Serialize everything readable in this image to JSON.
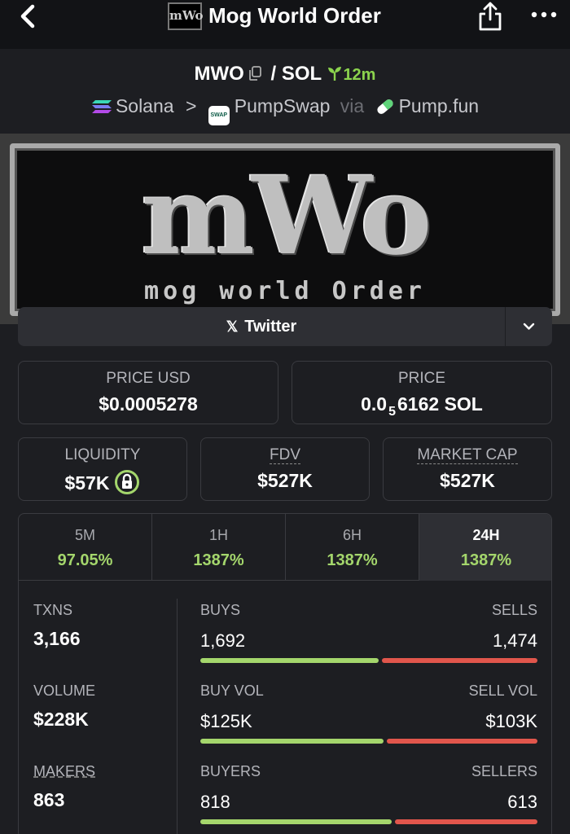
{
  "header": {
    "title": "Mog World Order",
    "logo_text": "mWo"
  },
  "pair": {
    "base": "MWO",
    "separator": "/",
    "quote": "SOL",
    "age": "12m"
  },
  "chain": {
    "network": "Solana",
    "arrow": ">",
    "dex": "PumpSwap",
    "dex_badge": "SWAP",
    "via": "via",
    "launchpad": "Pump.fun"
  },
  "banner": {
    "logo": "mWo",
    "subtitle": "mog world Order"
  },
  "social": {
    "twitter_label": "Twitter",
    "x_glyph": "𝕏"
  },
  "prices": {
    "price_usd_label": "PRICE USD",
    "price_usd": "$0.0005278",
    "price_label": "PRICE",
    "price_main": "0.0",
    "price_zeros": "5",
    "price_rest": "6162 SOL"
  },
  "metrics": {
    "liquidity_label": "LIQUIDITY",
    "liquidity": "$57K",
    "fdv_label": "FDV",
    "fdv": "$527K",
    "mcap_label": "MARKET CAP",
    "mcap": "$527K"
  },
  "tabs": [
    {
      "label": "5M",
      "pct": "97.05%"
    },
    {
      "label": "1H",
      "pct": "1387%"
    },
    {
      "label": "6H",
      "pct": "1387%"
    },
    {
      "label": "24H",
      "pct": "1387%"
    }
  ],
  "stats": {
    "txns_label": "TXNS",
    "txns": "3,166",
    "volume_label": "VOLUME",
    "volume": "$228K",
    "makers_label": "MAKERS",
    "makers": "863",
    "buys_label": "BUYS",
    "buys": "1,692",
    "sells_label": "SELLS",
    "sells": "1,474",
    "buy_vol_label": "BUY VOL",
    "buy_vol": "$125K",
    "sell_vol_label": "SELL VOL",
    "sell_vol": "$103K",
    "buyers_label": "BUYERS",
    "buyers": "818",
    "sellers_label": "SELLERS",
    "sellers": "613",
    "buys_ratio": 0.534,
    "buy_vol_ratio": 0.548,
    "buyers_ratio": 0.572
  },
  "colors": {
    "accent_green": "#a4d66c",
    "sell_red": "#e1564c",
    "background": "#1d1e22"
  }
}
